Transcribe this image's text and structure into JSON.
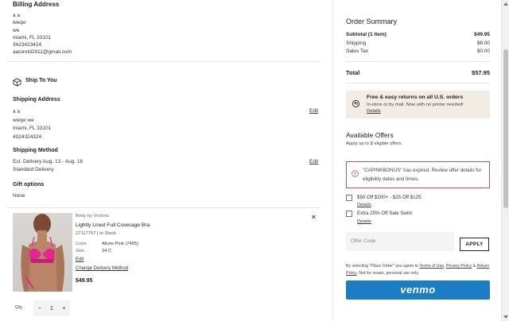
{
  "billing": {
    "title": "Billing Address",
    "lines": [
      "a a",
      "weqw",
      "we",
      "miami, FL 33101",
      "3423423424",
      "aaronrld2911@gmail.com"
    ]
  },
  "ship_to_you": {
    "label": "Ship To You"
  },
  "shipping_address": {
    "title": "Shipping Address",
    "edit": "Edit",
    "lines": [
      "a a",
      "weqw we",
      "miami, FL 33101",
      "4324324324"
    ]
  },
  "shipping_method": {
    "title": "Shipping Method",
    "edit": "Edit",
    "delivery": "Est. Delivery Aug. 13 - Aug. 18",
    "method": "Standard Delivery"
  },
  "gift_options": {
    "title": "Gift options",
    "value": "None"
  },
  "product": {
    "brand": "Body by Victoria",
    "name": "Lightly Lined Full Coverage Bra",
    "sku_stock": "27117757 | In Stock",
    "color_label": "Color",
    "color_value": "Allure Pink (7455)",
    "size_label": "Size",
    "size_value": "34 C",
    "edit": "Edit",
    "change_delivery": "Change Delivery Method",
    "price": "$49.95",
    "remove_glyph": "✕",
    "qty_label": "Qty",
    "qty_minus": "−",
    "qty_value": "1",
    "qty_plus": "+"
  },
  "order_summary": {
    "title": "Order Summary",
    "subtotal_label": "Subtotal (1 Item)",
    "subtotal_value": "$49.95",
    "shipping_label": "Shipping",
    "shipping_value": "$8.00",
    "tax_label": "Sales Tax",
    "tax_value": "$0.00",
    "total_label": "Total",
    "total_value": "$57.95"
  },
  "returns": {
    "title": "Free & easy returns on all U.S. orders",
    "subtitle": "In-store or by mail. Now with no printer needed!",
    "details": "Details"
  },
  "offers": {
    "title": "Available Offers",
    "subtitle_prefix": "Apply up to ",
    "subtitle_count": "2",
    "subtitle_suffix": " eligible offers.",
    "expired_message": "\"CAPINKBONUS\" has expired. Review offer details for eligibility dates and times.",
    "offer1": "$50 Off $200+ - $25 Off $125",
    "offer1_details": "Details",
    "offer2": "Extra 25% Off Sale Swim",
    "offer2_details": "Details",
    "code_placeholder": "Offer Code",
    "apply": "APPLY"
  },
  "legal": {
    "prefix": "By selecting \"Place Order\" you agree to ",
    "terms": "Terms of Use",
    "comma": ",",
    "privacy": "Privacy Policy",
    "amp": " & ",
    "return": "Return Policy",
    "suffix": ". Not for resale, personal use only."
  },
  "venmo": {
    "label": "venmo"
  },
  "colors": {
    "venmo_blue": "#1b7ec5",
    "returns_bg": "#f3ece4",
    "error_red": "#c0584f",
    "bra_pink": "#e0288f"
  }
}
